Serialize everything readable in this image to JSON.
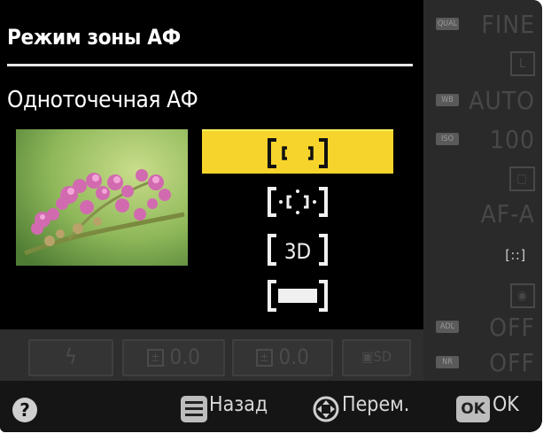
{
  "menu": {
    "title": "Режим зоны АФ",
    "current_mode": "Одноточечная АФ",
    "options": [
      {
        "icon": "single-point-af-icon",
        "selected": true
      },
      {
        "icon": "dynamic-area-af-icon",
        "selected": false
      },
      {
        "icon": "3d-tracking-af-icon",
        "label": "3D",
        "selected": false
      },
      {
        "icon": "auto-area-af-icon",
        "selected": false
      }
    ],
    "highlight_color": "#f6d42b"
  },
  "info_panel": {
    "quality": "FINE",
    "size_label": "L",
    "wb": "AUTO",
    "iso": "100",
    "focus_mode": "AF-A",
    "af_area_indicator": "[::]",
    "adl": "OFF",
    "nr": "OFF"
  },
  "bottom_strip": {
    "flash_comp": "0.0",
    "exposure_comp": "0.0"
  },
  "footer": {
    "help": "?",
    "back_label": "Назад",
    "move_label": "Перем.",
    "ok_key": "OK",
    "ok_label": "OK"
  }
}
